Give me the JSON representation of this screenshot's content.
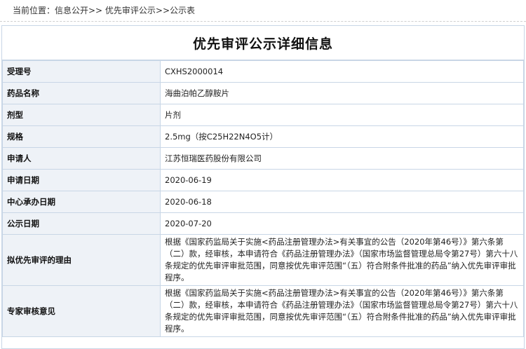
{
  "breadcrumb": "当前位置：信息公开>> 优先审评公示>>公示表",
  "page_title": "优先审评公示详细信息",
  "rows": [
    {
      "label": "受理号",
      "value": "CXHS2000014"
    },
    {
      "label": "药品名称",
      "value": "海曲泊帕乙醇胺片"
    },
    {
      "label": "剂型",
      "value": "片剂"
    },
    {
      "label": "规格",
      "value": "2.5mg（按C25H22N4O5计）"
    },
    {
      "label": "申请人",
      "value": "江苏恒瑞医药股份有限公司"
    },
    {
      "label": "申请日期",
      "value": "2020-06-19"
    },
    {
      "label": "中心承办日期",
      "value": "2020-06-18"
    },
    {
      "label": "公示日期",
      "value": "2020-07-20"
    },
    {
      "label": "拟优先审评的理由",
      "value": "根据《国家药监局关于实施<药品注册管理办法>有关事宜的公告（2020年第46号）》第六条第（二）款，经审核，本申请符合《药品注册管理办法》（国家市场监督管理总局令第27号）第六十八条规定的优先审评审批范围，同意按优先审评范围“（五）符合附条件批准的药品”纳入优先审评审批程序。"
    },
    {
      "label": "专家审核意见",
      "value": "根据《国家药监局关于实施<药品注册管理办法>有关事宜的公告（2020年第46号）》第六条第（二）款，经审核，本申请符合《药品注册管理办法》（国家市场监督管理总局令第27号）第六十八条规定的优先审评审批范围，同意按优先审评范围“（五）符合附条件批准的药品”纳入优先审评审批程序。"
    }
  ]
}
